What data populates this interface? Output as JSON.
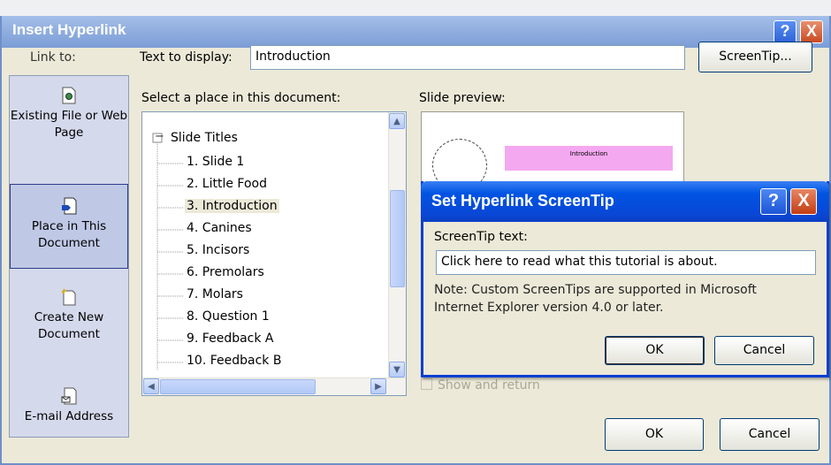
{
  "dialog": {
    "title": "Insert Hyperlink",
    "help_glyph": "?",
    "close_glyph": "X"
  },
  "link_to": {
    "label": "Link to:",
    "items": [
      {
        "label": "Existing File or Web Page",
        "icon": "existing-file-icon",
        "selected": false
      },
      {
        "label": "Place in This Document",
        "icon": "place-in-document-icon",
        "selected": true
      },
      {
        "label": "Create New Document",
        "icon": "new-document-icon",
        "selected": false
      },
      {
        "label": "E-mail Address",
        "icon": "email-address-icon",
        "selected": false
      }
    ]
  },
  "text_to_display": {
    "label": "Text to display:",
    "value": "Introduction"
  },
  "screentip_button": "ScreenTip...",
  "place_list": {
    "label": "Select a place in this document:",
    "root": "Slide Titles",
    "root_glyph": "−",
    "items": [
      {
        "label": "1. Slide 1",
        "selected": false
      },
      {
        "label": "2. Little Food",
        "selected": false
      },
      {
        "label": "3. Introduction",
        "selected": true
      },
      {
        "label": "4. Canines",
        "selected": false
      },
      {
        "label": "5. Incisors",
        "selected": false
      },
      {
        "label": "6. Premolars",
        "selected": false
      },
      {
        "label": "7. Molars",
        "selected": false
      },
      {
        "label": "8. Question 1",
        "selected": false
      },
      {
        "label": "9. Feedback A",
        "selected": false
      },
      {
        "label": "10. Feedback B",
        "selected": false
      }
    ]
  },
  "preview": {
    "label": "Slide preview:",
    "slide_title": "Introduction",
    "accent_color": "#f4a8f0"
  },
  "show_and_return": "Show and return",
  "buttons": {
    "ok": "OK",
    "cancel": "Cancel"
  },
  "screentip_dialog": {
    "title": "Set Hyperlink ScreenTip",
    "help_glyph": "?",
    "close_glyph": "X",
    "text_label": "ScreenTip text:",
    "text_value": "Click here to read what this tutorial is about.",
    "note": "Note: Custom ScreenTips are supported in Microsoft Internet Explorer version 4.0 or later.",
    "ok": "OK",
    "cancel": "Cancel"
  }
}
